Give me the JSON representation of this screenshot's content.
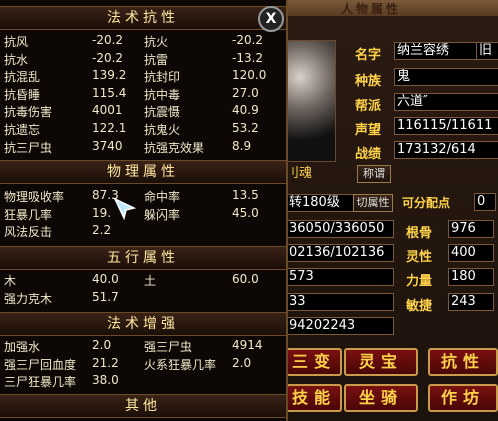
{
  "char": {
    "title": "人物属性",
    "name_label": "名字",
    "name_value": "纳兰容绣",
    "race_label": "种族",
    "race_value": "鬼",
    "faction_label": "帮派",
    "faction_value": "六道″",
    "fame_label": "声望",
    "fame_value": "116115/11611",
    "battle_label": "战绩",
    "battle_value": "173132/614",
    "title_btn": "称谓",
    "tag_right": "旧",
    "spirit_label": "刂魂",
    "level_value": "转180级",
    "tab_label": "切属性",
    "alloc_label": "可分配点",
    "alloc_value": "0",
    "hp_value": "36050/336050",
    "mp_value": "02136/102136",
    "val3": "573",
    "val4": "33",
    "val5": "94202243",
    "stats": [
      {
        "label": "根骨",
        "value": "976"
      },
      {
        "label": "灵性",
        "value": "400"
      },
      {
        "label": "力量",
        "value": "180"
      },
      {
        "label": "敏捷",
        "value": "243"
      }
    ],
    "buttons": [
      "三变",
      "灵宝",
      "抗性",
      "技能",
      "坐骑",
      "作坊"
    ]
  },
  "popup": {
    "sections": [
      {
        "title": "法术抗性"
      },
      {
        "title": "物理属性"
      },
      {
        "title": "五行属性"
      },
      {
        "title": "法术增强"
      },
      {
        "title": "其他"
      }
    ],
    "close_label": "X",
    "resist": [
      [
        "抗风",
        "-20.2",
        "抗火",
        "-20.2"
      ],
      [
        "抗水",
        "-20.2",
        "抗雷",
        "-13.2"
      ],
      [
        "抗混乱",
        "139.2",
        "抗封印",
        "120.0"
      ],
      [
        "抗昏睡",
        "115.4",
        "抗中毒",
        "27.0"
      ],
      [
        "抗毒伤害",
        "4001",
        "抗震慑",
        "40.9"
      ],
      [
        "抗遗忘",
        "122.1",
        "抗鬼火",
        "53.2"
      ],
      [
        "抗三尸虫",
        "3740",
        "抗强克效果",
        "8.9"
      ]
    ],
    "physical": [
      [
        "物理吸收率",
        "87.3",
        "命中率",
        "13.5"
      ],
      [
        "狂暴几率",
        "19.",
        "躲闪率",
        "45.0"
      ],
      [
        "风法反击",
        "2.2",
        "",
        ""
      ]
    ],
    "elements": [
      [
        "木",
        "40.0",
        "土",
        "60.0"
      ],
      [
        "强力克木",
        "51.7",
        "",
        ""
      ]
    ],
    "boost": [
      [
        "加强水",
        "2.0",
        "强三尸虫",
        "4914"
      ],
      [
        "强三尸回血度",
        "21.2",
        "火系狂暴几率",
        "2.0"
      ],
      [
        "三尸狂暴几率",
        "38.0",
        "",
        ""
      ]
    ]
  }
}
